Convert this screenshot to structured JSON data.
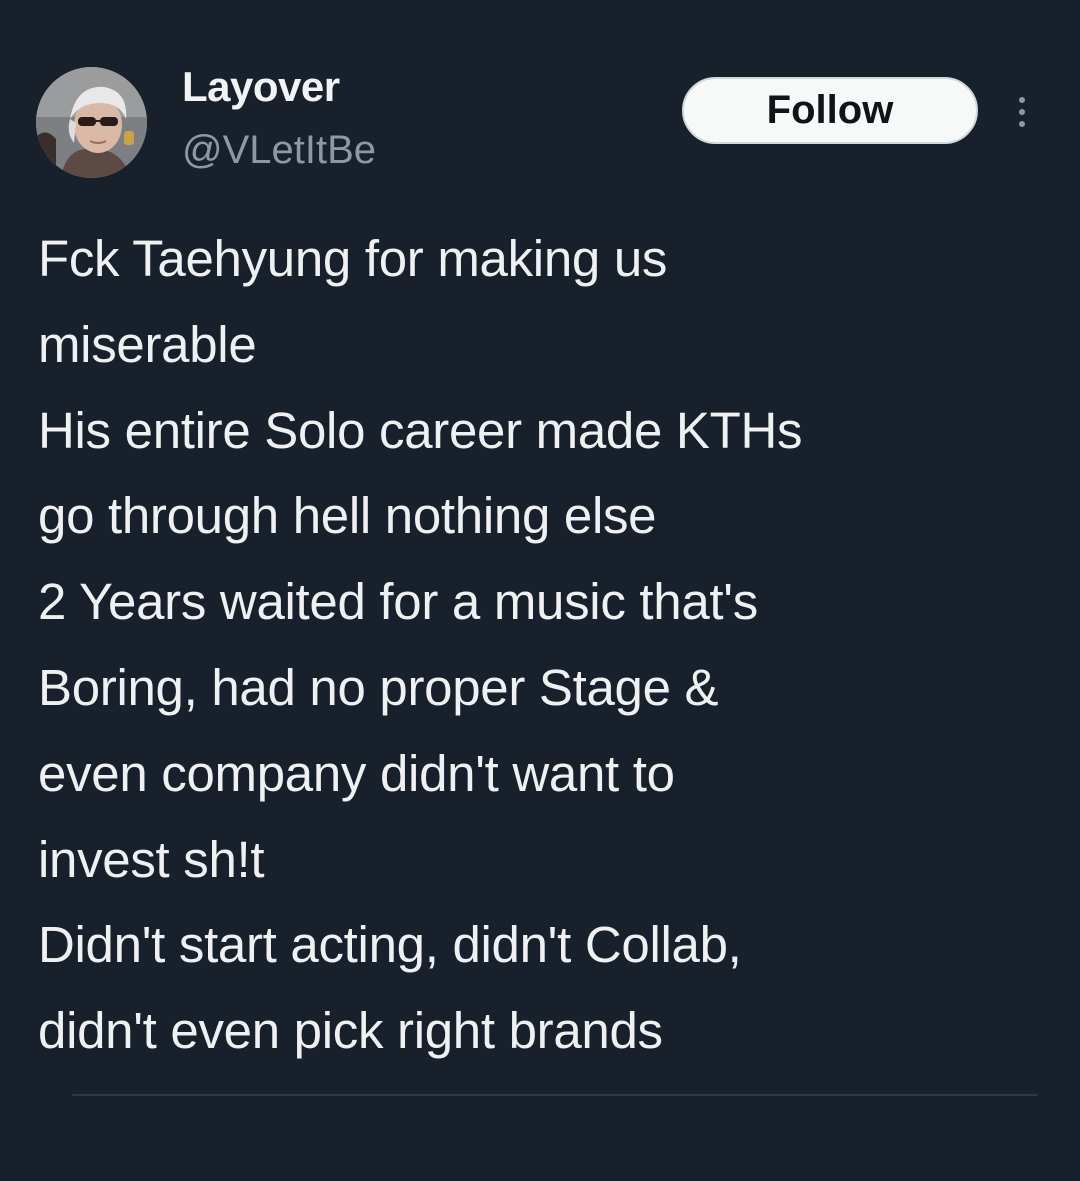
{
  "user": {
    "display_name": "Layover",
    "handle": "@VLetItBe"
  },
  "actions": {
    "follow_label": "Follow",
    "more_icon": "more-vertical-icon"
  },
  "tweet": {
    "lines": [
      "Fck Taehyung for making us",
      "miserable",
      "His entire Solo career made KTHs",
      "go through hell nothing else",
      "2 Years waited for a music that's",
      "Boring, had no proper Stage &",
      "even company didn't want to",
      "invest sh!t",
      "Didn't start acting, didn't Collab,",
      "didn't even pick right brands"
    ]
  },
  "colors": {
    "background": "#17202b",
    "text": "#e7e9ea",
    "secondary_text": "#8b98a5",
    "follow_bg": "#f7f9f9"
  }
}
